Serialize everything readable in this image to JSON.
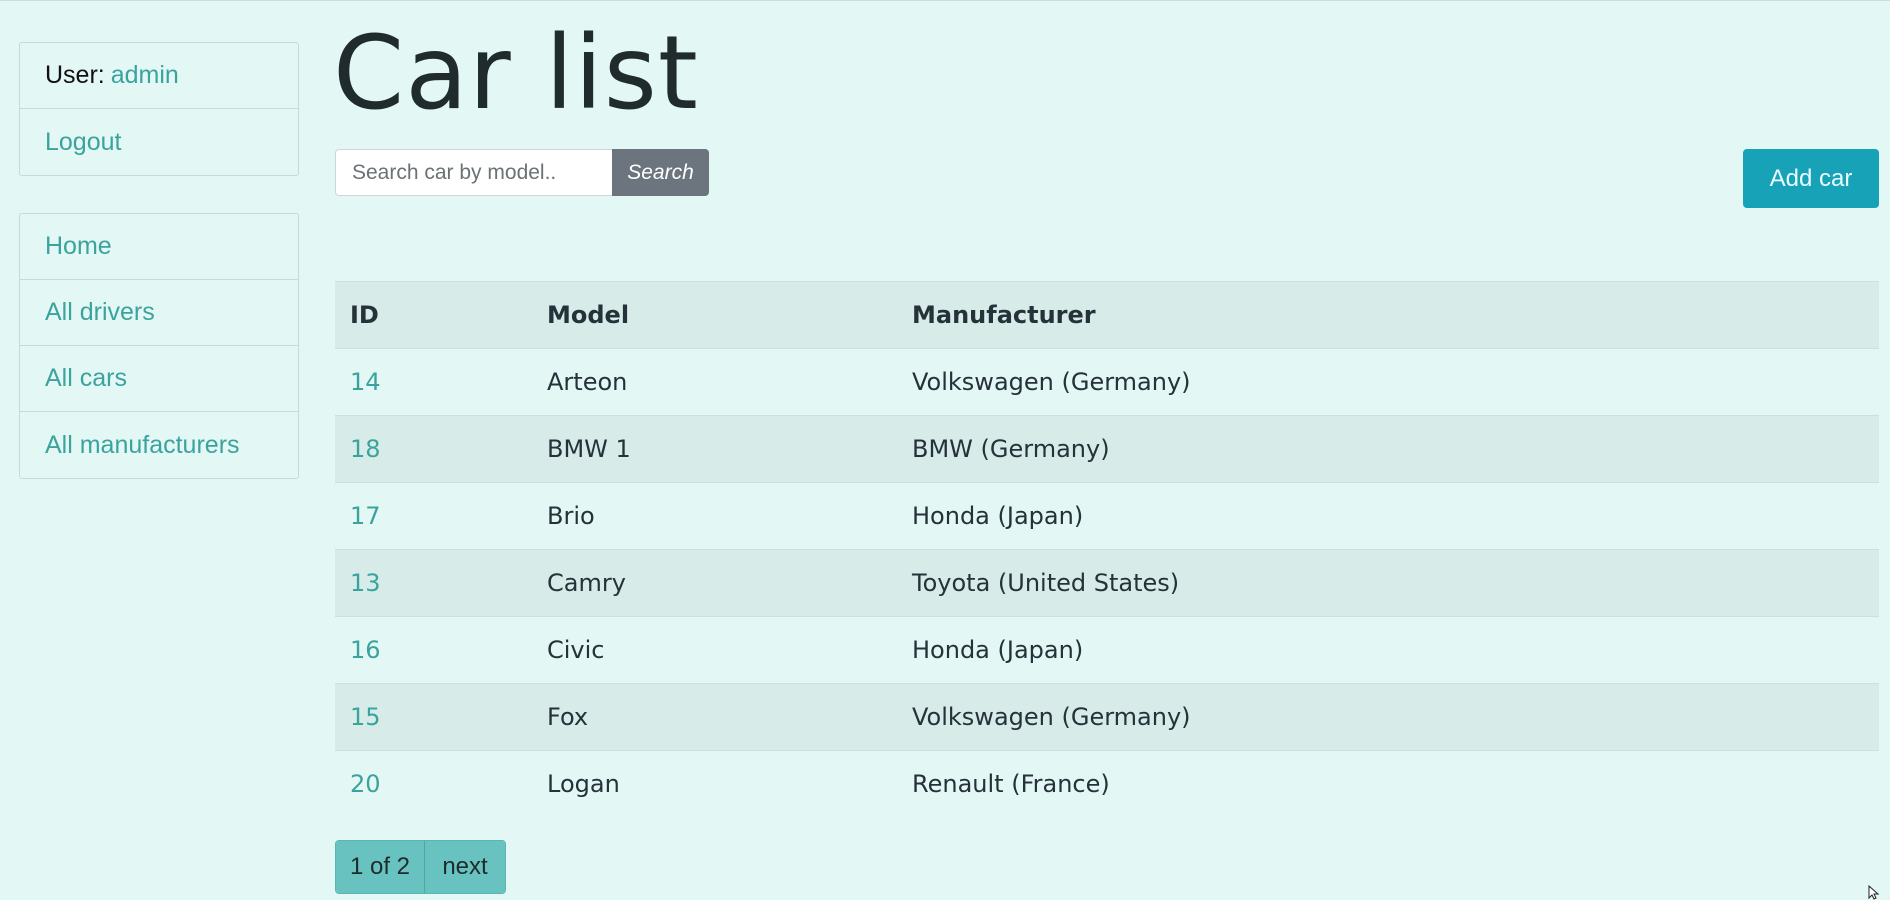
{
  "user": {
    "label": "User:",
    "name": "admin"
  },
  "logout_label": "Logout",
  "nav": [
    {
      "label": "Home"
    },
    {
      "label": "All drivers"
    },
    {
      "label": "All cars"
    },
    {
      "label": "All manufacturers"
    }
  ],
  "page_title": "Car list",
  "search": {
    "placeholder": "Search car by model..",
    "button_label": "Search"
  },
  "add_button_label": "Add car",
  "table": {
    "headers": [
      "ID",
      "Model",
      "Manufacturer"
    ],
    "rows": [
      {
        "id": "14",
        "model": "Arteon",
        "manufacturer": "Volkswagen (Germany)"
      },
      {
        "id": "18",
        "model": "BMW 1",
        "manufacturer": "BMW (Germany)"
      },
      {
        "id": "17",
        "model": "Brio",
        "manufacturer": "Honda (Japan)"
      },
      {
        "id": "13",
        "model": "Camry",
        "manufacturer": "Toyota (United States)"
      },
      {
        "id": "16",
        "model": "Civic",
        "manufacturer": "Honda (Japan)"
      },
      {
        "id": "15",
        "model": "Fox",
        "manufacturer": "Volkswagen (Germany)"
      },
      {
        "id": "20",
        "model": "Logan",
        "manufacturer": "Renault (France)"
      }
    ]
  },
  "pagination": {
    "current": "1 of 2",
    "next": "next"
  },
  "colors": {
    "background": "#e3f7f4",
    "link": "#3ba39e",
    "accent": "#17a2b8",
    "search_button": "#6c757d",
    "striped_row": "#d7ece8",
    "pagination": "#68c2bf"
  }
}
